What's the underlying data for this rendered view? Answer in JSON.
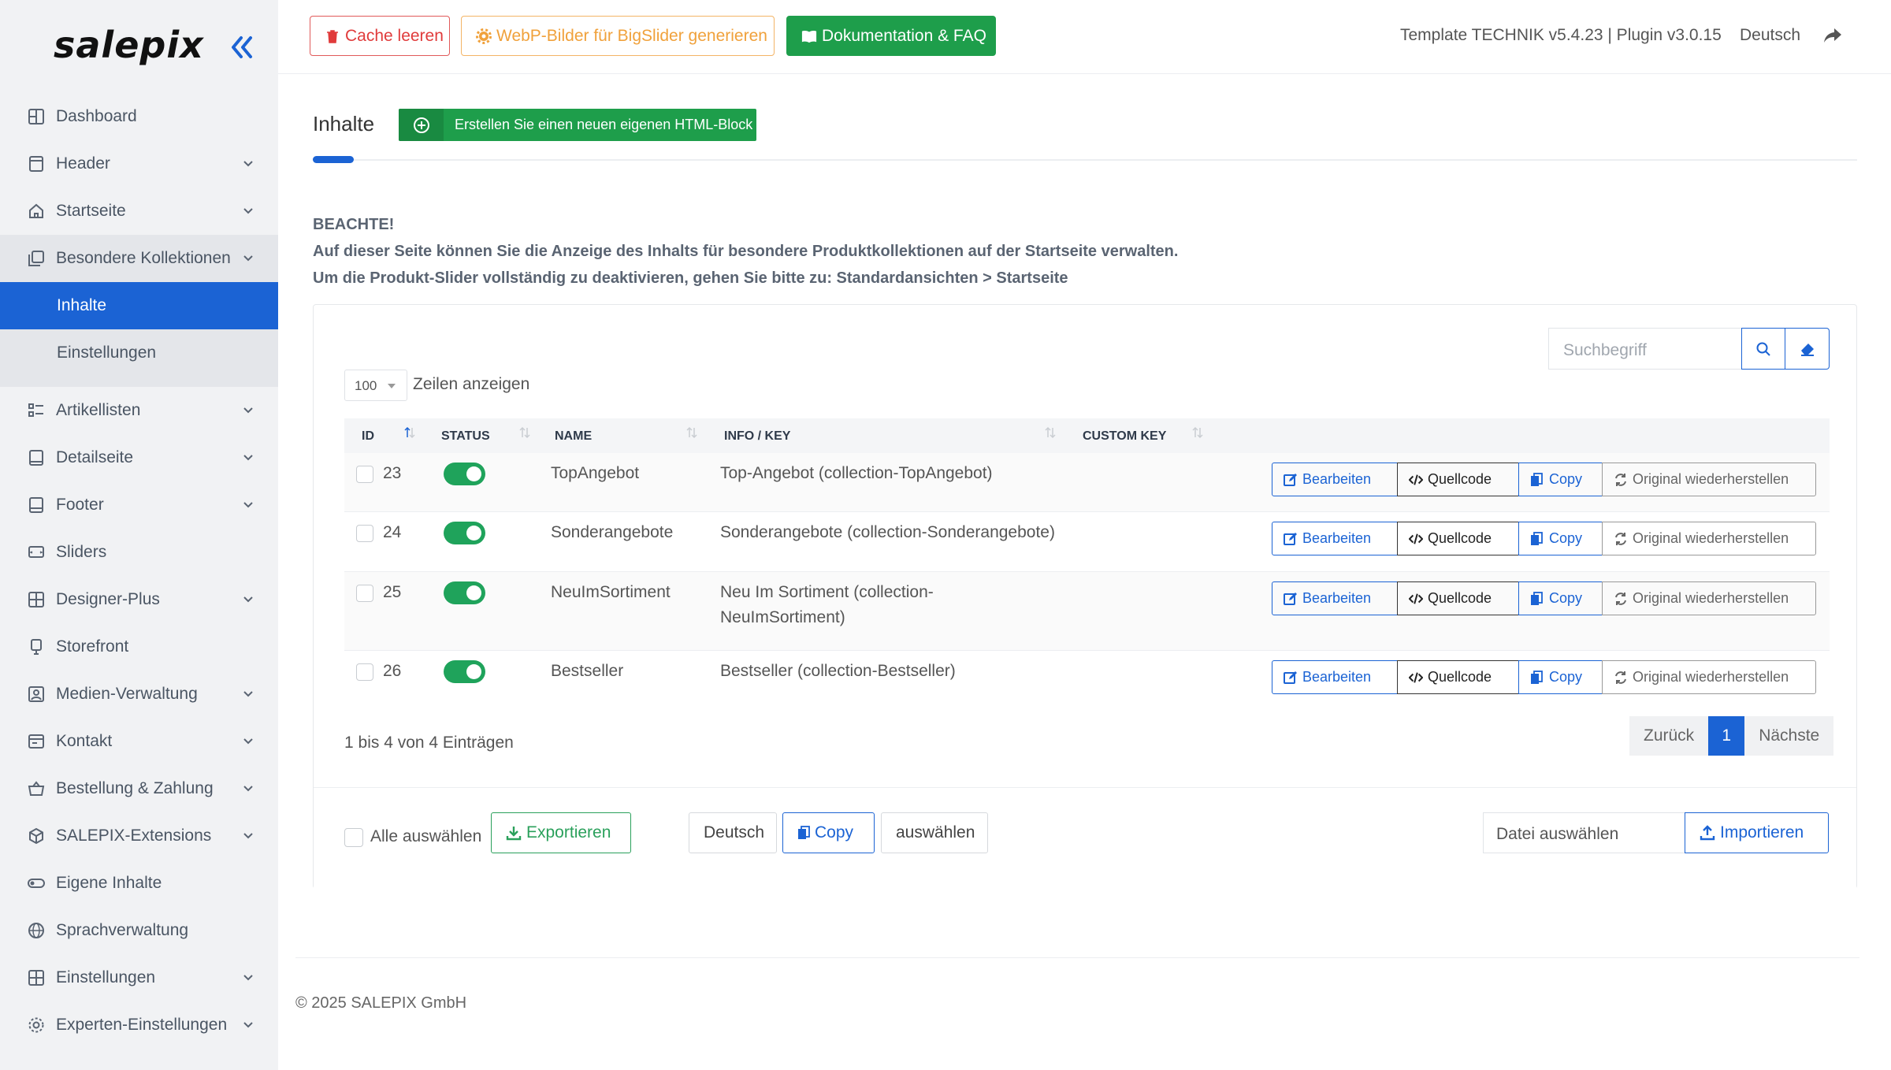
{
  "app": {
    "logo": "salepix"
  },
  "sidebar": {
    "items": [
      {
        "label": "Dashboard",
        "icon": "dashboard-icon",
        "chevron": false
      },
      {
        "label": "Header",
        "icon": "header-icon",
        "chevron": true
      },
      {
        "label": "Startseite",
        "icon": "home-icon",
        "chevron": true
      },
      {
        "label": "Besondere Kollektionen",
        "icon": "collections-icon",
        "chevron": true
      },
      {
        "label": "Artikellisten",
        "icon": "list-icon",
        "chevron": true
      },
      {
        "label": "Detailseite",
        "icon": "detail-icon",
        "chevron": true
      },
      {
        "label": "Footer",
        "icon": "footer-icon",
        "chevron": true
      },
      {
        "label": "Sliders",
        "icon": "slider-icon",
        "chevron": false
      },
      {
        "label": "Designer-Plus",
        "icon": "designer-icon",
        "chevron": true
      },
      {
        "label": "Storefront",
        "icon": "storefront-icon",
        "chevron": false
      },
      {
        "label": "Medien-Verwaltung",
        "icon": "media-icon",
        "chevron": true
      },
      {
        "label": "Kontakt",
        "icon": "contact-icon",
        "chevron": true
      },
      {
        "label": "Bestellung & Zahlung",
        "icon": "basket-icon",
        "chevron": true
      },
      {
        "label": "SALEPIX-Extensions",
        "icon": "cube-icon",
        "chevron": true
      },
      {
        "label": "Eigene Inhalte",
        "icon": "toggle-icon",
        "chevron": false
      },
      {
        "label": "Sprachverwaltung",
        "icon": "globe-icon",
        "chevron": false
      },
      {
        "label": "Einstellungen",
        "icon": "grid-icon",
        "chevron": true
      },
      {
        "label": "Experten-Einstellungen",
        "icon": "gear-icon",
        "chevron": true
      }
    ],
    "sub_items": [
      {
        "label": "Inhalte",
        "active": true
      },
      {
        "label": "Einstellungen",
        "active": false
      }
    ]
  },
  "topbar": {
    "cache_label": "Cache leeren",
    "webp_label": "WebP-Bilder für BigSlider generieren",
    "doc_label": "Dokumentation & FAQ",
    "version": "Template TECHNIK v5.4.23 | Plugin v3.0.15",
    "language": "Deutsch"
  },
  "page": {
    "title": "Inhalte",
    "create_label": "Erstellen Sie einen neuen eigenen HTML-Block",
    "notice_title": "BEACHTE!",
    "notice_line1": "Auf dieser Seite können Sie die Anzeige des Inhalts für besondere Produktkollektionen auf der Startseite verwalten.",
    "notice_line2": "Um die Produkt-Slider vollständig zu deaktivieren, gehen Sie bitte zu: Standardansichten > Startseite"
  },
  "table": {
    "search_placeholder": "Suchbegriff",
    "page_length": "100",
    "page_length_label": "Zeilen anzeigen",
    "columns": {
      "id": "ID",
      "status": "STATUS",
      "name": "NAME",
      "info": "INFO / KEY",
      "custom": "CUSTOM KEY"
    },
    "rows": [
      {
        "id": "23",
        "name": "TopAngebot",
        "info": "Top-Angebot (collection-TopAngebot)",
        "info2": "",
        "enabled": true
      },
      {
        "id": "24",
        "name": "Sonderangebote",
        "info": "Sonderangebote (collection-Sonderangebote)",
        "info2": "",
        "enabled": true
      },
      {
        "id": "25",
        "name": "NeuImSortiment",
        "info": "Neu Im Sortiment (collection-",
        "info2": "NeuImSortiment)",
        "enabled": true
      },
      {
        "id": "26",
        "name": "Bestseller",
        "info": "Bestseller (collection-Bestseller)",
        "info2": "",
        "enabled": true
      }
    ],
    "actions": {
      "edit": "Bearbeiten",
      "source": "Quellcode",
      "copy": "Copy",
      "restore": "Original wiederherstellen"
    },
    "info_count": "1 bis 4 von 4 Einträgen",
    "pager": {
      "prev": "Zurück",
      "current": "1",
      "next": "Nächste"
    }
  },
  "footer_bar": {
    "select_all": "Alle auswählen",
    "export": "Exportieren",
    "language": "Deutsch",
    "copy": "Copy",
    "choose": "auswählen",
    "file_label": "Datei auswählen",
    "import": "Importieren"
  },
  "copyright": "© 2025 SALEPIX GmbH",
  "colors": {
    "primary": "#1b63d4",
    "success": "#1e9e4b",
    "danger": "#e03b3b",
    "warning": "#f0a13b"
  }
}
